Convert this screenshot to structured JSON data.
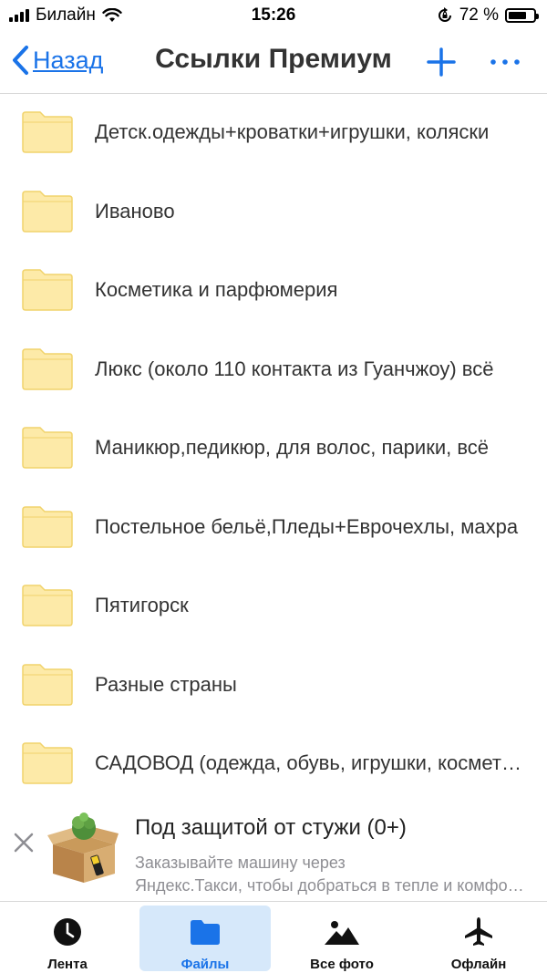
{
  "status_bar": {
    "carrier": "Билайн",
    "time": "15:26",
    "battery_percent": "72 %",
    "battery_level": 0.72
  },
  "nav": {
    "back_label": "Назад",
    "title": "Ссылки Премиум"
  },
  "folders": [
    "Детск.одежды+кроватки+игрушки, коляски",
    "Иваново",
    "Косметика и парфюмерия",
    "Люкс (около 110 контакта из Гуанчжоу) всё",
    "Маникюр,педикюр, для волос, парики, всё",
    "Постельное бельё,Пледы+Еврочехлы, махра",
    "Пятигорск",
    "Разные страны",
    "САДОВОД (одежда, обувь, игрушки, косметика)"
  ],
  "ad": {
    "title": "Под защитой от стужи (0+)",
    "text_line1": "Заказывайте машину через",
    "text_line2": "Яндекс.Такси, чтобы добраться в тепле и комфорте"
  },
  "tabs": [
    {
      "label": "Лента",
      "icon": "clock-icon",
      "active": false
    },
    {
      "label": "Файлы",
      "icon": "folder-icon",
      "active": true
    },
    {
      "label": "Все фото",
      "icon": "mountain-icon",
      "active": false
    },
    {
      "label": "Офлайн",
      "icon": "airplane-icon",
      "active": false
    }
  ],
  "colors": {
    "accent": "#1a73e8",
    "folder_fill": "#fdeaa8",
    "folder_stroke": "#f1d36c",
    "active_tab_bg": "#d6e8fa"
  }
}
